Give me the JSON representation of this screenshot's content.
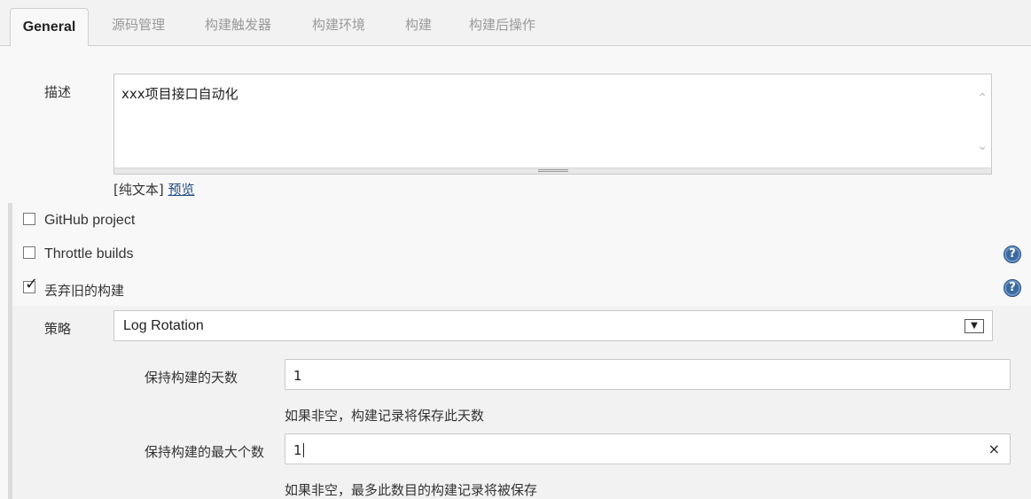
{
  "tabs": [
    {
      "label": "General",
      "active": true
    },
    {
      "label": "源码管理"
    },
    {
      "label": "构建触发器"
    },
    {
      "label": "构建环境"
    },
    {
      "label": "构建"
    },
    {
      "label": "构建后操作"
    }
  ],
  "description": {
    "label": "描述",
    "value": "xxx项目接口自动化",
    "format_label": "[纯文本]",
    "preview_link": "预览"
  },
  "options": {
    "github_project": {
      "label": "GitHub project",
      "checked": false
    },
    "throttle_builds": {
      "label": "Throttle builds",
      "checked": false
    },
    "discard_old_builds": {
      "label": "丢弃旧的构建",
      "checked": true
    }
  },
  "help_icon": "?",
  "strategy": {
    "label": "策略",
    "selected": "Log Rotation",
    "dropdown_icon": "chevron-down-icon"
  },
  "days_to_keep": {
    "label": "保持构建的天数",
    "value": "1",
    "hint": "如果非空，构建记录将保存此天数"
  },
  "max_builds": {
    "label": "保持构建的最大个数",
    "value": "1",
    "clear_icon": "×",
    "hint": "如果非空，最多此数目的构建记录将被保存"
  },
  "colors": {
    "background": "#f8f8f8",
    "help_icon": "#3c6aa0",
    "link": "#204a87"
  }
}
